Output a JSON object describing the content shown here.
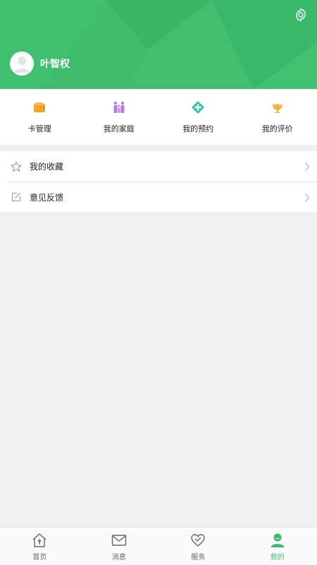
{
  "profile": {
    "username": "叶智权",
    "accent_color": "#3cbb6a"
  },
  "header_icons": [
    "settings-gear-icon"
  ],
  "quick_actions": [
    {
      "label": "卡管理",
      "icon": "wallet-icon",
      "color": "#f5a623"
    },
    {
      "label": "我的家庭",
      "icon": "family-icon",
      "color": "#b77be8"
    },
    {
      "label": "我的预约",
      "icon": "appointment-diamond-icon",
      "color": "#2ec4a6"
    },
    {
      "label": "我的评价",
      "icon": "review-flower-icon",
      "color": "#f5b53a"
    }
  ],
  "menu": [
    {
      "label": "我的收藏",
      "icon": "star-icon"
    },
    {
      "label": "意见反馈",
      "icon": "edit-icon"
    }
  ],
  "tabbar": {
    "tabs": [
      {
        "label": "首页",
        "icon": "home-icon"
      },
      {
        "label": "消息",
        "icon": "mail-icon"
      },
      {
        "label": "服务",
        "icon": "heart-icon"
      },
      {
        "label": "我的",
        "icon": "user-icon"
      }
    ],
    "active_index": 3
  }
}
